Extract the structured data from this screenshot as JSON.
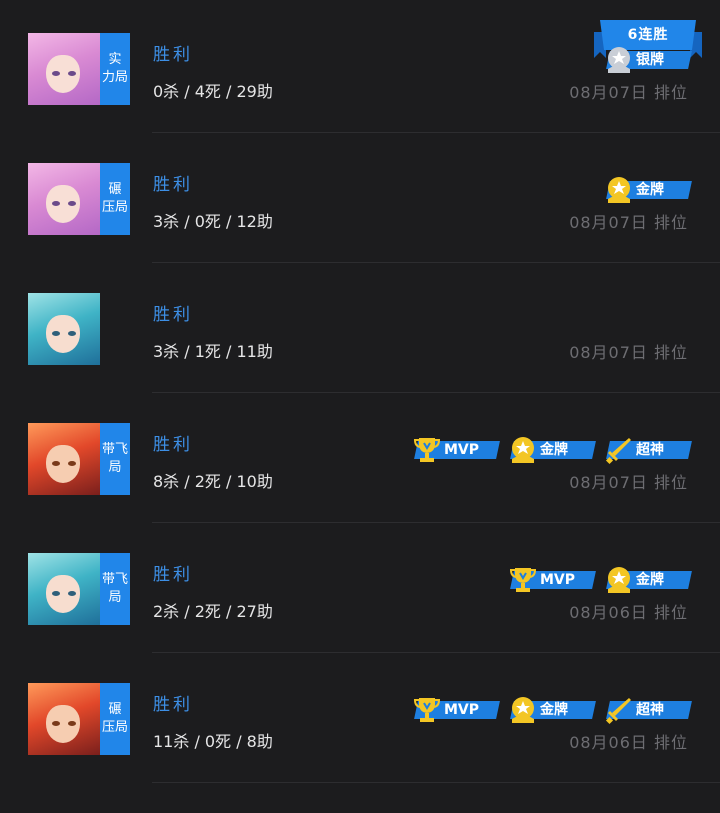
{
  "streak": {
    "label": "6连胜"
  },
  "colors": {
    "accent": "#2186e9",
    "result": "#3d8fe6",
    "gold": "#f3c624",
    "silver": "#c9ced6"
  },
  "matches": [
    {
      "hero": "pink-hair-hero",
      "mode_tag": "实\n力局",
      "result": "胜利",
      "kda": "0杀 / 4死 / 29助",
      "date_info": "08月07日 排位",
      "badges": [
        {
          "type": "silver",
          "label": "银牌"
        }
      ]
    },
    {
      "hero": "pink-hair-hero",
      "mode_tag": "碾\n压局",
      "result": "胜利",
      "kda": "3杀 / 0死 / 12助",
      "date_info": "08月07日 排位",
      "badges": [
        {
          "type": "gold",
          "label": "金牌"
        }
      ]
    },
    {
      "hero": "teal-hair-hero",
      "mode_tag": "",
      "result": "胜利",
      "kda": "3杀 / 1死 / 11助",
      "date_info": "08月07日 排位",
      "badges": []
    },
    {
      "hero": "red-hair-hero",
      "mode_tag": "带飞\n局",
      "result": "胜利",
      "kda": "8杀 / 2死 / 10助",
      "date_info": "08月07日 排位",
      "badges": [
        {
          "type": "mvp",
          "label": "MVP"
        },
        {
          "type": "gold",
          "label": "金牌"
        },
        {
          "type": "legendary",
          "label": "超神"
        }
      ]
    },
    {
      "hero": "teal-hair-hero",
      "mode_tag": "带飞\n局",
      "result": "胜利",
      "kda": "2杀 / 2死 / 27助",
      "date_info": "08月06日 排位",
      "badges": [
        {
          "type": "mvp",
          "label": "MVP"
        },
        {
          "type": "gold",
          "label": "金牌"
        }
      ]
    },
    {
      "hero": "red-hair-hero",
      "mode_tag": "碾\n压局",
      "result": "胜利",
      "kda": "11杀 / 0死 / 8助",
      "date_info": "08月06日 排位",
      "badges": [
        {
          "type": "mvp",
          "label": "MVP"
        },
        {
          "type": "gold",
          "label": "金牌"
        },
        {
          "type": "legendary",
          "label": "超神"
        }
      ]
    }
  ]
}
